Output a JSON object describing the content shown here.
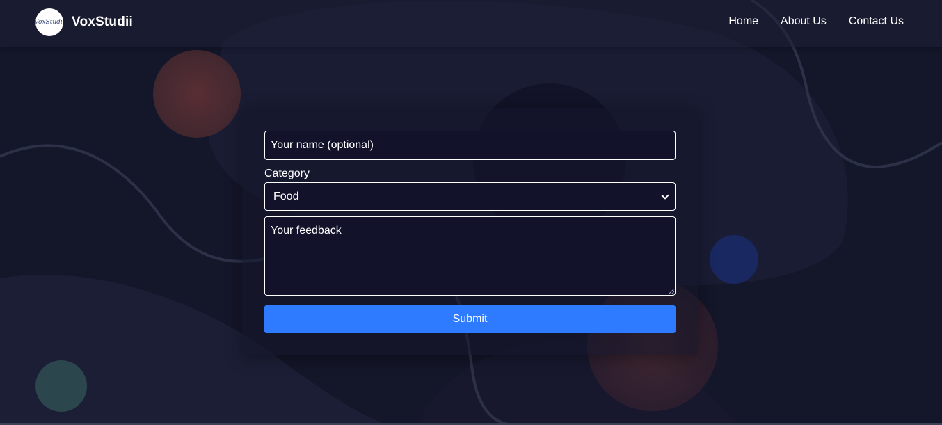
{
  "header": {
    "brand_name": "VoxStudii",
    "logo_text": "VoxStudii",
    "nav": [
      {
        "label": "Home"
      },
      {
        "label": "About Us"
      },
      {
        "label": "Contact Us"
      }
    ]
  },
  "form": {
    "name_placeholder": "Your name (optional)",
    "category_label": "Category",
    "category_selected": "Food",
    "feedback_placeholder": "Your feedback",
    "submit_label": "Submit"
  },
  "colors": {
    "background": "#141629",
    "accent": "#2f7bff",
    "bubble_orange": "#5a3033",
    "bubble_teal": "#2f4d52",
    "bubble_blue": "#1b2a66"
  }
}
